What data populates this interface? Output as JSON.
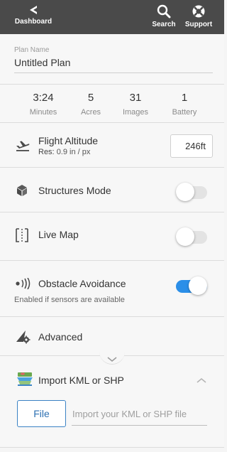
{
  "topbar": {
    "dashboard_label": "Dashboard",
    "search_label": "Search",
    "support_label": "Support"
  },
  "plan": {
    "label": "Plan Name",
    "name": "Untitled Plan"
  },
  "stats": [
    {
      "value": "3:24",
      "label": "Minutes"
    },
    {
      "value": "5",
      "label": "Acres"
    },
    {
      "value": "31",
      "label": "Images"
    },
    {
      "value": "1",
      "label": "Battery"
    }
  ],
  "altitude": {
    "title": "Flight Altitude",
    "res_prefix": "Res:",
    "res_value": "0.9 in / px",
    "value": "246ft"
  },
  "structures": {
    "title": "Structures Mode",
    "enabled": false
  },
  "livemap": {
    "title": "Live Map",
    "enabled": false
  },
  "obstacle": {
    "title": "Obstacle Avoidance",
    "subtitle": "Enabled if sensors are available",
    "enabled": true
  },
  "advanced": {
    "title": "Advanced"
  },
  "import": {
    "title": "Import KML or SHP",
    "file_button": "File",
    "placeholder": "Import your KML or SHP file"
  },
  "colors": {
    "topbar": "#4a4a4a",
    "accent": "#2b8fe8",
    "file_button": "#2c6fb2"
  }
}
